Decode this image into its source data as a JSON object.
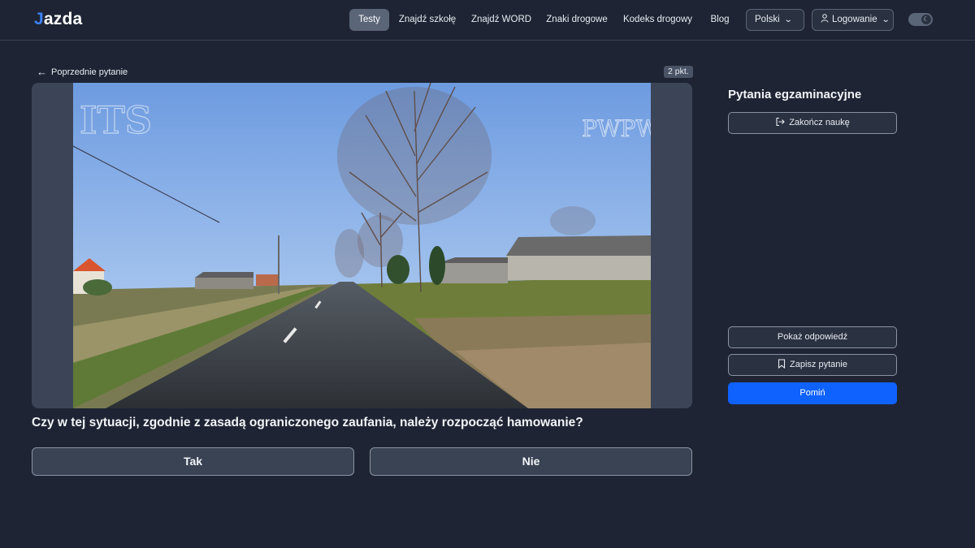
{
  "header": {
    "logo_letter": "J",
    "logo_rest": "azda",
    "nav": [
      {
        "label": "Testy",
        "active": true
      },
      {
        "label": "Znajdź szkołę"
      },
      {
        "label": "Znajdź WORD"
      },
      {
        "label": "Znaki drogowe"
      },
      {
        "label": "Kodeks drogowy"
      },
      {
        "label": "Blog"
      }
    ],
    "language": "Polski",
    "login": "Logowanie",
    "theme_toggle_icon": "moon-icon"
  },
  "question": {
    "back_label": "Poprzednie pytanie",
    "points": "2 pkt.",
    "text": "Czy w tej sytuacji, zgodnie z zasadą ograniczonego zaufania, należy rozpocząć hamowanie?",
    "answers": [
      "Tak",
      "Nie"
    ],
    "media": {
      "watermark_left": "ITS",
      "watermark_right": "PWPW"
    }
  },
  "sidebar": {
    "title": "Pytania egzaminacyjne",
    "end_label": "Zakończ naukę",
    "show_answer_label": "Pokaż odpowiedź",
    "save_label": "Zapisz pytanie",
    "skip_label": "Pomiń"
  },
  "colors": {
    "background": "#1e2433",
    "accent": "#0f62fe"
  }
}
